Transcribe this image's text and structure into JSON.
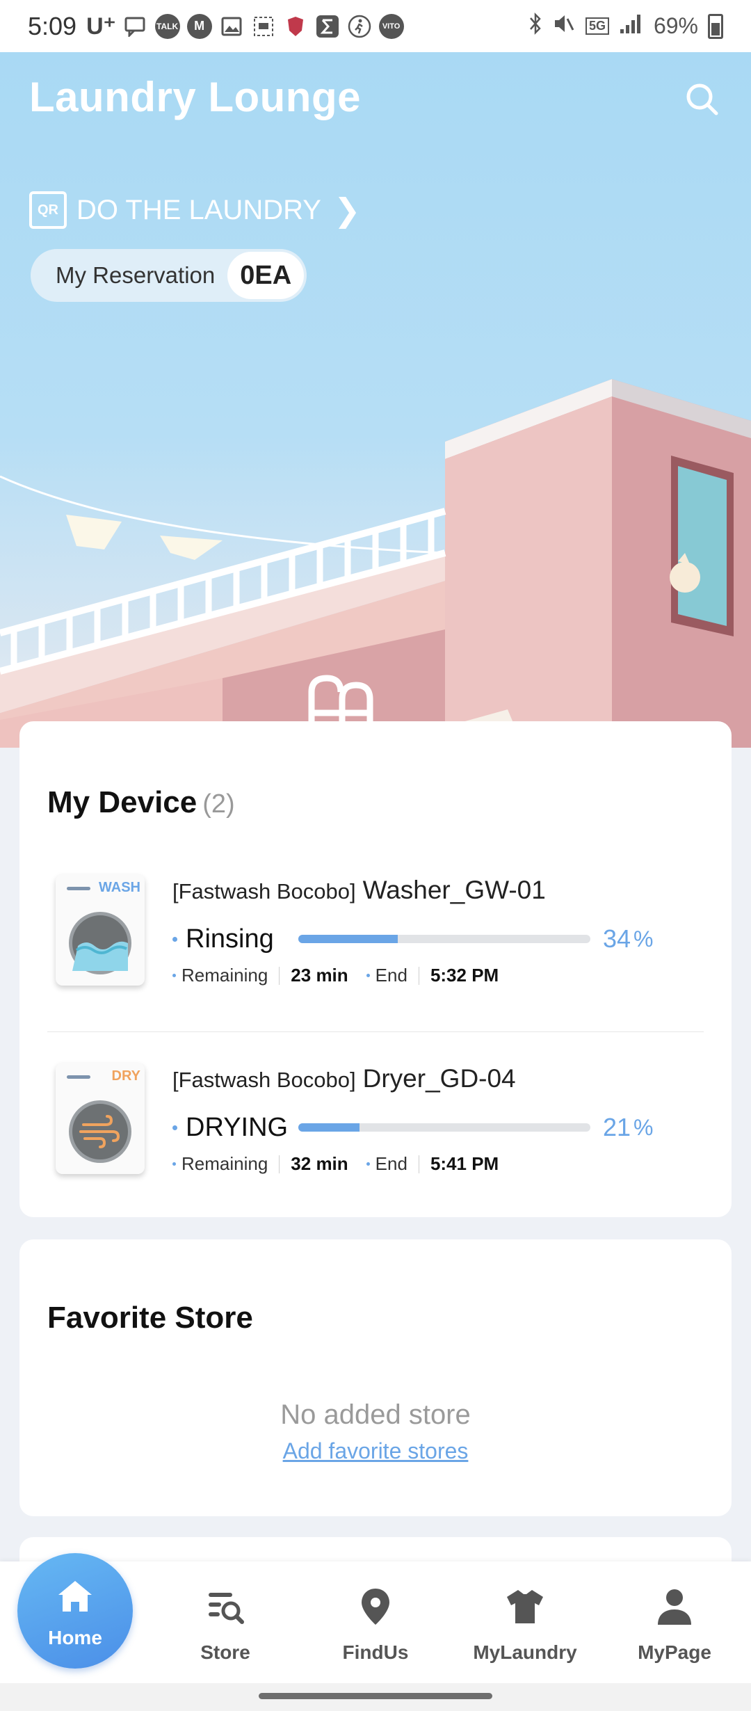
{
  "status_bar": {
    "time": "5:09",
    "carrier": "U⁺",
    "network": "5G",
    "battery": "69%"
  },
  "header": {
    "app_title": "Laundry Lounge",
    "qr_badge": "QR",
    "do_laundry": "DO THE LAUNDRY",
    "reservation_label": "My Reservation",
    "reservation_count": "0EA"
  },
  "devices_section": {
    "title": "My Device",
    "count": "(2)",
    "items": [
      {
        "tag": "WASH",
        "tag_color": "#6aa5e6",
        "brand": "[Fastwash Bocobo]",
        "model": "Washer_GW-01",
        "status": "Rinsing",
        "progress": 0.34,
        "percent": "34",
        "percent_unit": "%",
        "remaining_label": "Remaining",
        "remaining_value": "23 min",
        "end_label": "End",
        "end_value": "5:32 PM"
      },
      {
        "tag": "DRY",
        "tag_color": "#f0a35e",
        "brand": "[Fastwash Bocobo]",
        "model": "Dryer_GD-04",
        "status": "DRYING",
        "progress": 0.21,
        "percent": "21",
        "percent_unit": "%",
        "remaining_label": "Remaining",
        "remaining_value": "32 min",
        "end_label": "End",
        "end_value": "5:41 PM"
      }
    ]
  },
  "favorite_section": {
    "title": "Favorite Store",
    "empty_text": "No added store",
    "add_link": "Add favorite stores"
  },
  "nav": {
    "home": "Home",
    "store": "Store",
    "find_us": "FindUs",
    "my_laundry": "MyLaundry",
    "my_page": "MyPage"
  },
  "colors": {
    "accent": "#6aa5e6",
    "hero_sky": "#a9d9f4",
    "building_pink": "#e6b3b5"
  }
}
